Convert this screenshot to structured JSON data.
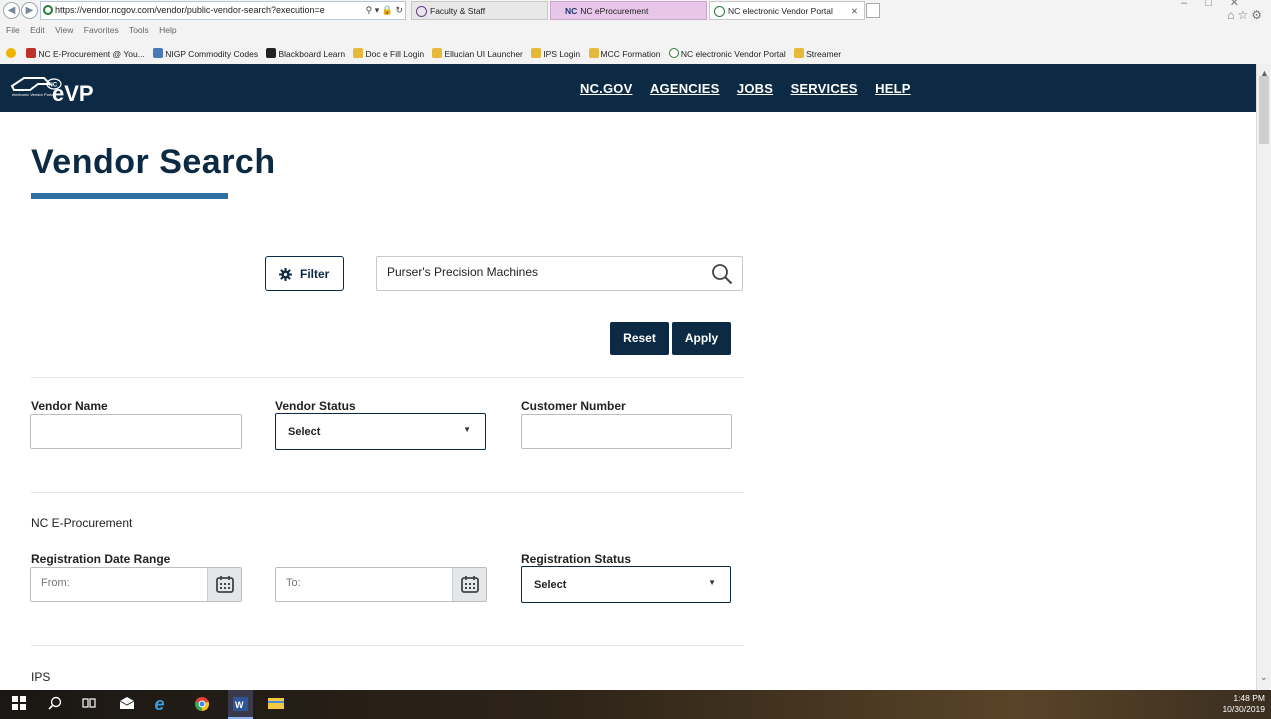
{
  "browser": {
    "url": "https://vendor.ncgov.com/vendor/public-vendor-search?execution=e",
    "tabs": [
      {
        "label": "Faculty & Staff"
      },
      {
        "label": "NC eProcurement",
        "badge": "NC"
      },
      {
        "label": "NC electronic Vendor Portal"
      }
    ],
    "menu": [
      "File",
      "Edit",
      "View",
      "Favorites",
      "Tools",
      "Help"
    ],
    "favorites": [
      "NC E-Procurement @ You...",
      "NIGP Commodity Codes",
      "Blackboard Learn",
      "Doc e Fill Login",
      "Ellucian UI Launcher",
      "IPS Login",
      "MCC Formation",
      "NC electronic Vendor Portal",
      "Streamer"
    ]
  },
  "site": {
    "logo_small": "electronic Vendor Portal",
    "logo_nc": "NC",
    "nav": [
      "NC.GOV",
      "AGENCIES",
      "JOBS",
      "SERVICES",
      "HELP"
    ]
  },
  "page": {
    "title": "Vendor Search",
    "filter_label": "Filter",
    "search_value": "Purser's Precision Machines",
    "reset_label": "Reset",
    "apply_label": "Apply",
    "vendor_name_label": "Vendor Name",
    "vendor_status_label": "Vendor Status",
    "vendor_status_value": "Select",
    "customer_number_label": "Customer Number",
    "section_eproc": "NC E-Procurement",
    "reg_date_label": "Registration Date Range",
    "from_placeholder": "From:",
    "to_placeholder": "To:",
    "reg_status_label": "Registration Status",
    "reg_status_value": "Select",
    "section_ips": "IPS"
  },
  "taskbar": {
    "time": "1:48 PM",
    "date": "10/30/2019"
  },
  "colors": {
    "navy": "#0d2a44",
    "accent_blue": "#2f6fa3"
  }
}
